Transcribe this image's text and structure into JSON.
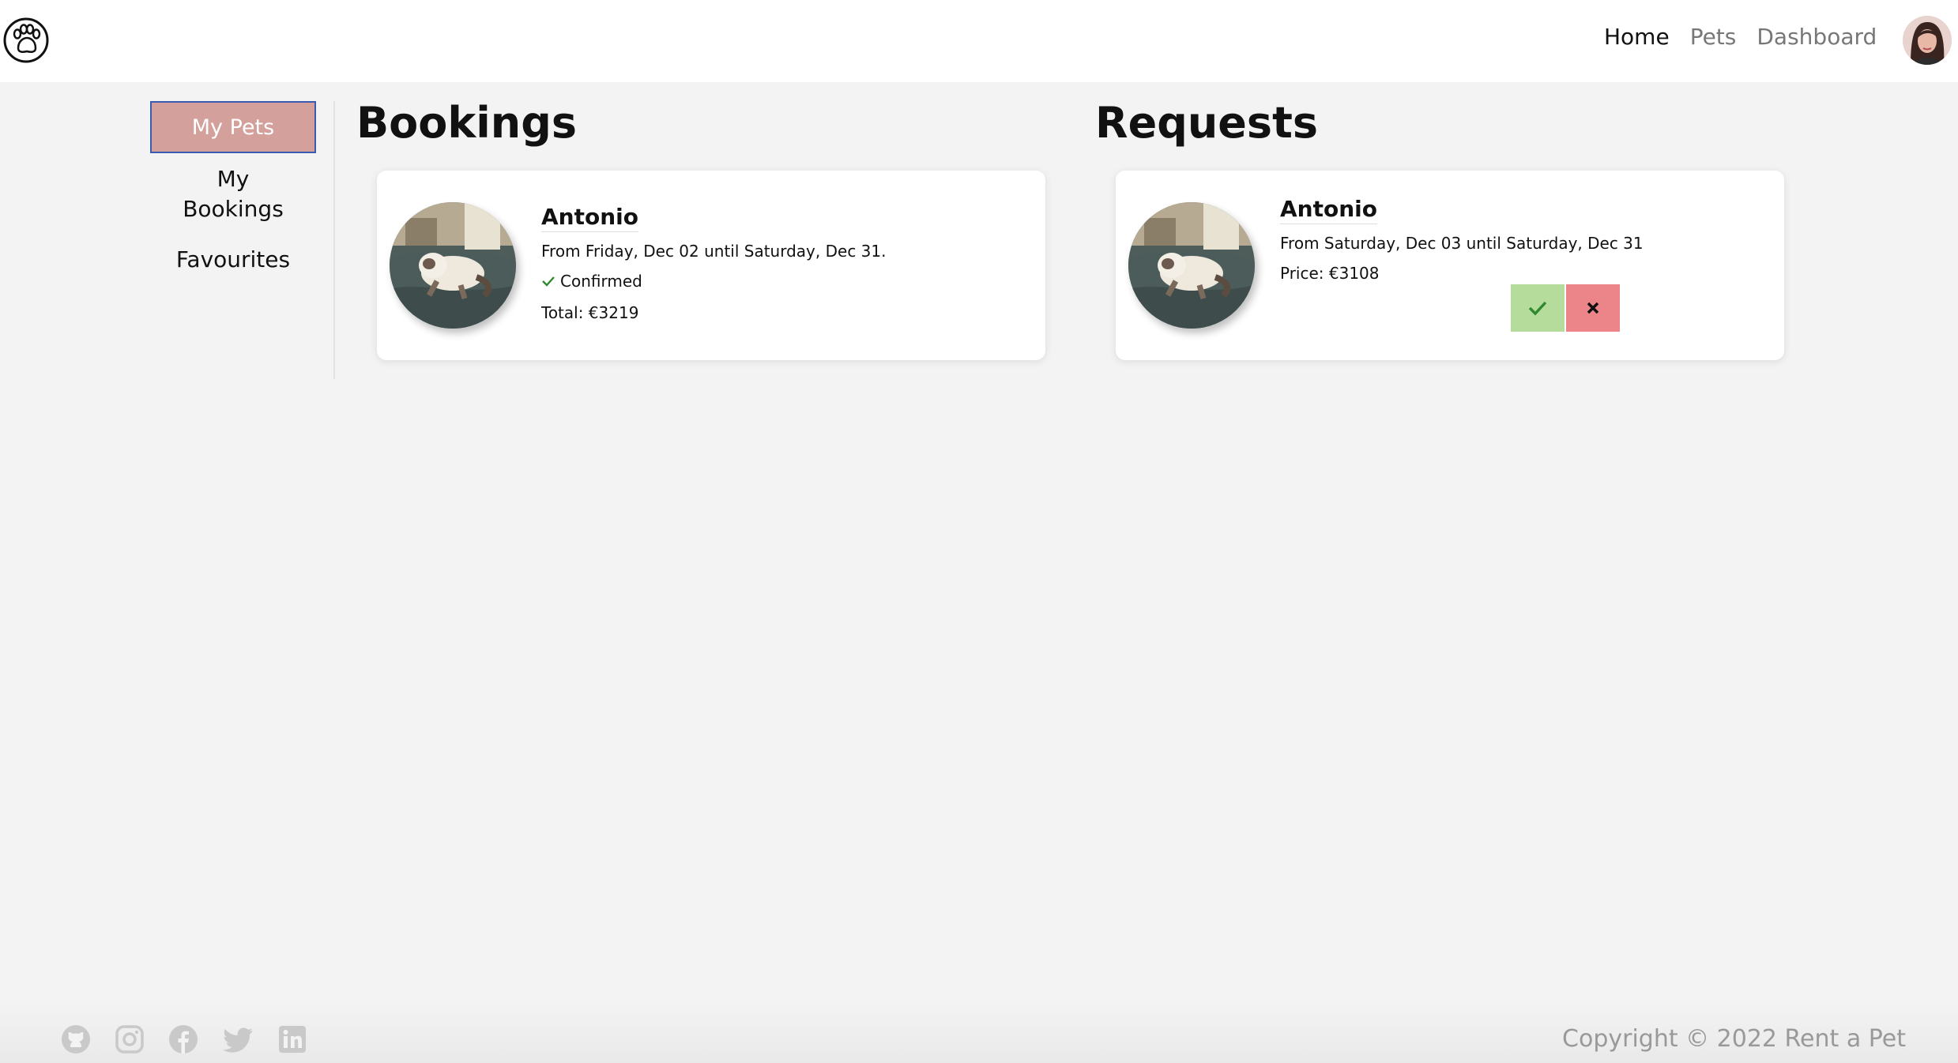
{
  "navbar": {
    "logo_icon": "paw-print-icon",
    "links": [
      {
        "label": "Home",
        "active": true
      },
      {
        "label": "Pets",
        "active": false
      },
      {
        "label": "Dashboard",
        "active": false
      }
    ]
  },
  "sidebar": {
    "active_item": "My Pets",
    "item_bookings_line1": "My",
    "item_bookings_line2": "Bookings",
    "item_favourites": "Favourites"
  },
  "bookings": {
    "title": "Bookings",
    "card": {
      "pet_name": "Antonio",
      "dates": "From Friday, Dec 02 until Saturday, Dec 31.",
      "status": "Confirmed",
      "total": "Total: €3219"
    }
  },
  "requests": {
    "title": "Requests",
    "card": {
      "pet_name": "Antonio",
      "dates": "From Saturday, Dec 03 until Saturday, Dec 31",
      "price": "Price: €3108"
    }
  },
  "footer": {
    "social_icons": [
      "github-icon",
      "instagram-icon",
      "facebook-icon",
      "twitter-icon",
      "linkedin-icon"
    ],
    "copyright": "Copyright © 2022 Rent a Pet"
  },
  "colors": {
    "active_sidebar": "#d3a09c",
    "accept": "#b6dc9c",
    "reject": "#ec8589",
    "background": "#f3f3f3"
  }
}
